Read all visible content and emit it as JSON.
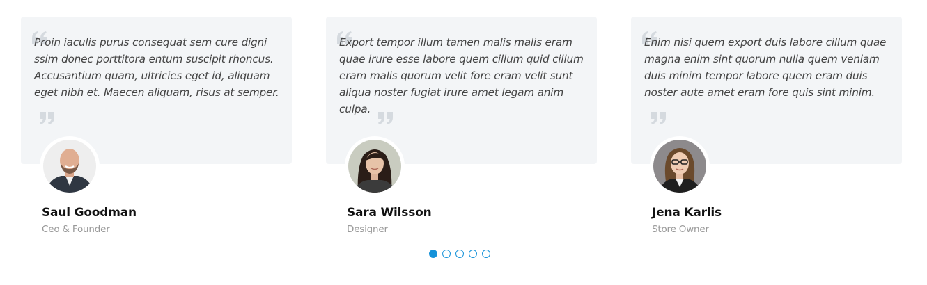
{
  "testimonials": [
    {
      "quote": "Proin iaculis purus consequat sem cure digni ssim donec porttitora entum suscipit rhoncus. Accusantium quam, ultricies eget id, aliquam eget nibh et. Maecen aliquam, risus at semper.",
      "name": "Saul Goodman",
      "role": "Ceo & Founder"
    },
    {
      "quote": "Export tempor illum tamen malis malis eram quae irure esse labore quem cillum quid cillum eram malis quorum velit fore eram velit sunt aliqua noster fugiat irure amet legam anim culpa.",
      "name": "Sara Wilsson",
      "role": "Designer"
    },
    {
      "quote": "Enim nisi quem export duis labore cillum quae magna enim sint quorum nulla quem veniam duis minim tempor labore quem eram duis noster aute amet eram fore quis sint minim.",
      "name": "Jena Karlis",
      "role": "Store Owner"
    }
  ],
  "pagination": {
    "total": 5,
    "active_index": 0
  },
  "colors": {
    "accent": "#1592d9",
    "card_background": "#f3f5f7",
    "quote_icon": "#d5dadf",
    "name_text": "#111111",
    "role_text": "#999999"
  },
  "icons": {
    "quote_open": "quote-left-icon",
    "quote_close": "quote-right-icon"
  }
}
